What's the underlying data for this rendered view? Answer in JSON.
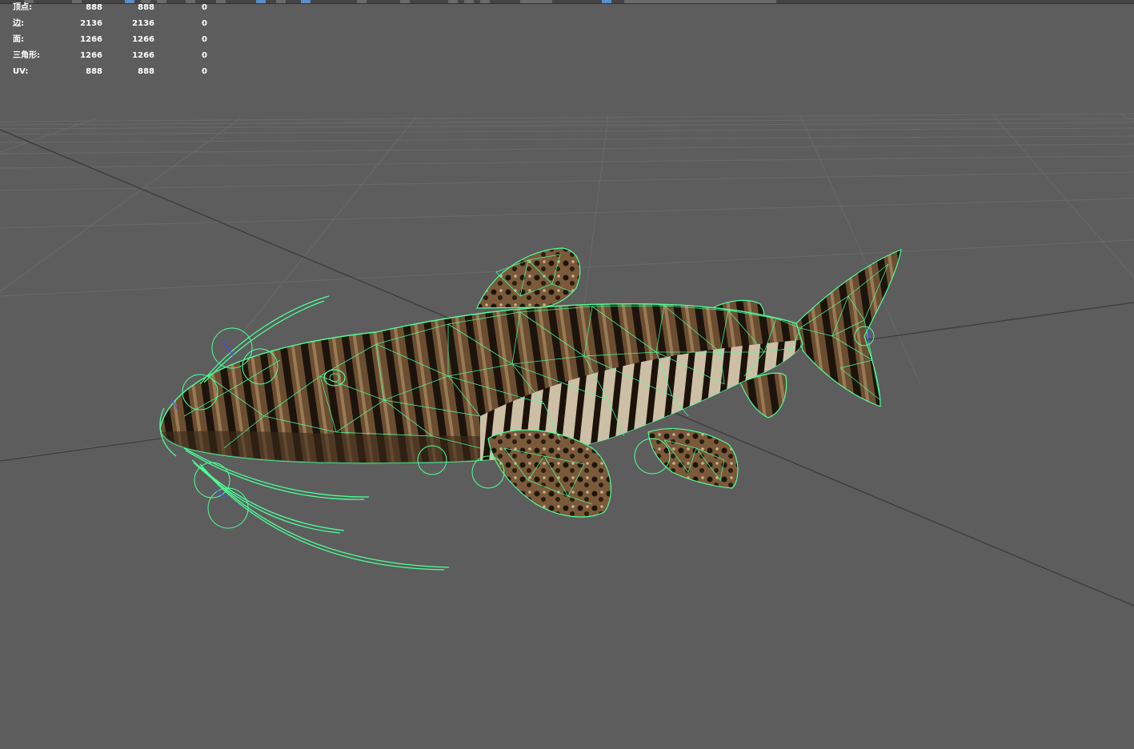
{
  "viewport": {
    "background": "#5d5d5d",
    "grid_color": "#6b6b6b",
    "axis_color": "#3a3a3a",
    "wire_color": "#4dff9a"
  },
  "hud": {
    "rows": [
      {
        "label": "顶点:",
        "c1": "888",
        "c2": "888",
        "c3": "0"
      },
      {
        "label": "边:",
        "c1": "2136",
        "c2": "2136",
        "c3": "0"
      },
      {
        "label": "面:",
        "c1": "1266",
        "c2": "1266",
        "c3": "0"
      },
      {
        "label": "三角形:",
        "c1": "1266",
        "c2": "1266",
        "c3": "0"
      },
      {
        "label": "UV:",
        "c1": "888",
        "c2": "888",
        "c3": "0"
      }
    ]
  },
  "model": {
    "icon": "catfish-mesh-icon",
    "texture": "tiger-stripe"
  }
}
